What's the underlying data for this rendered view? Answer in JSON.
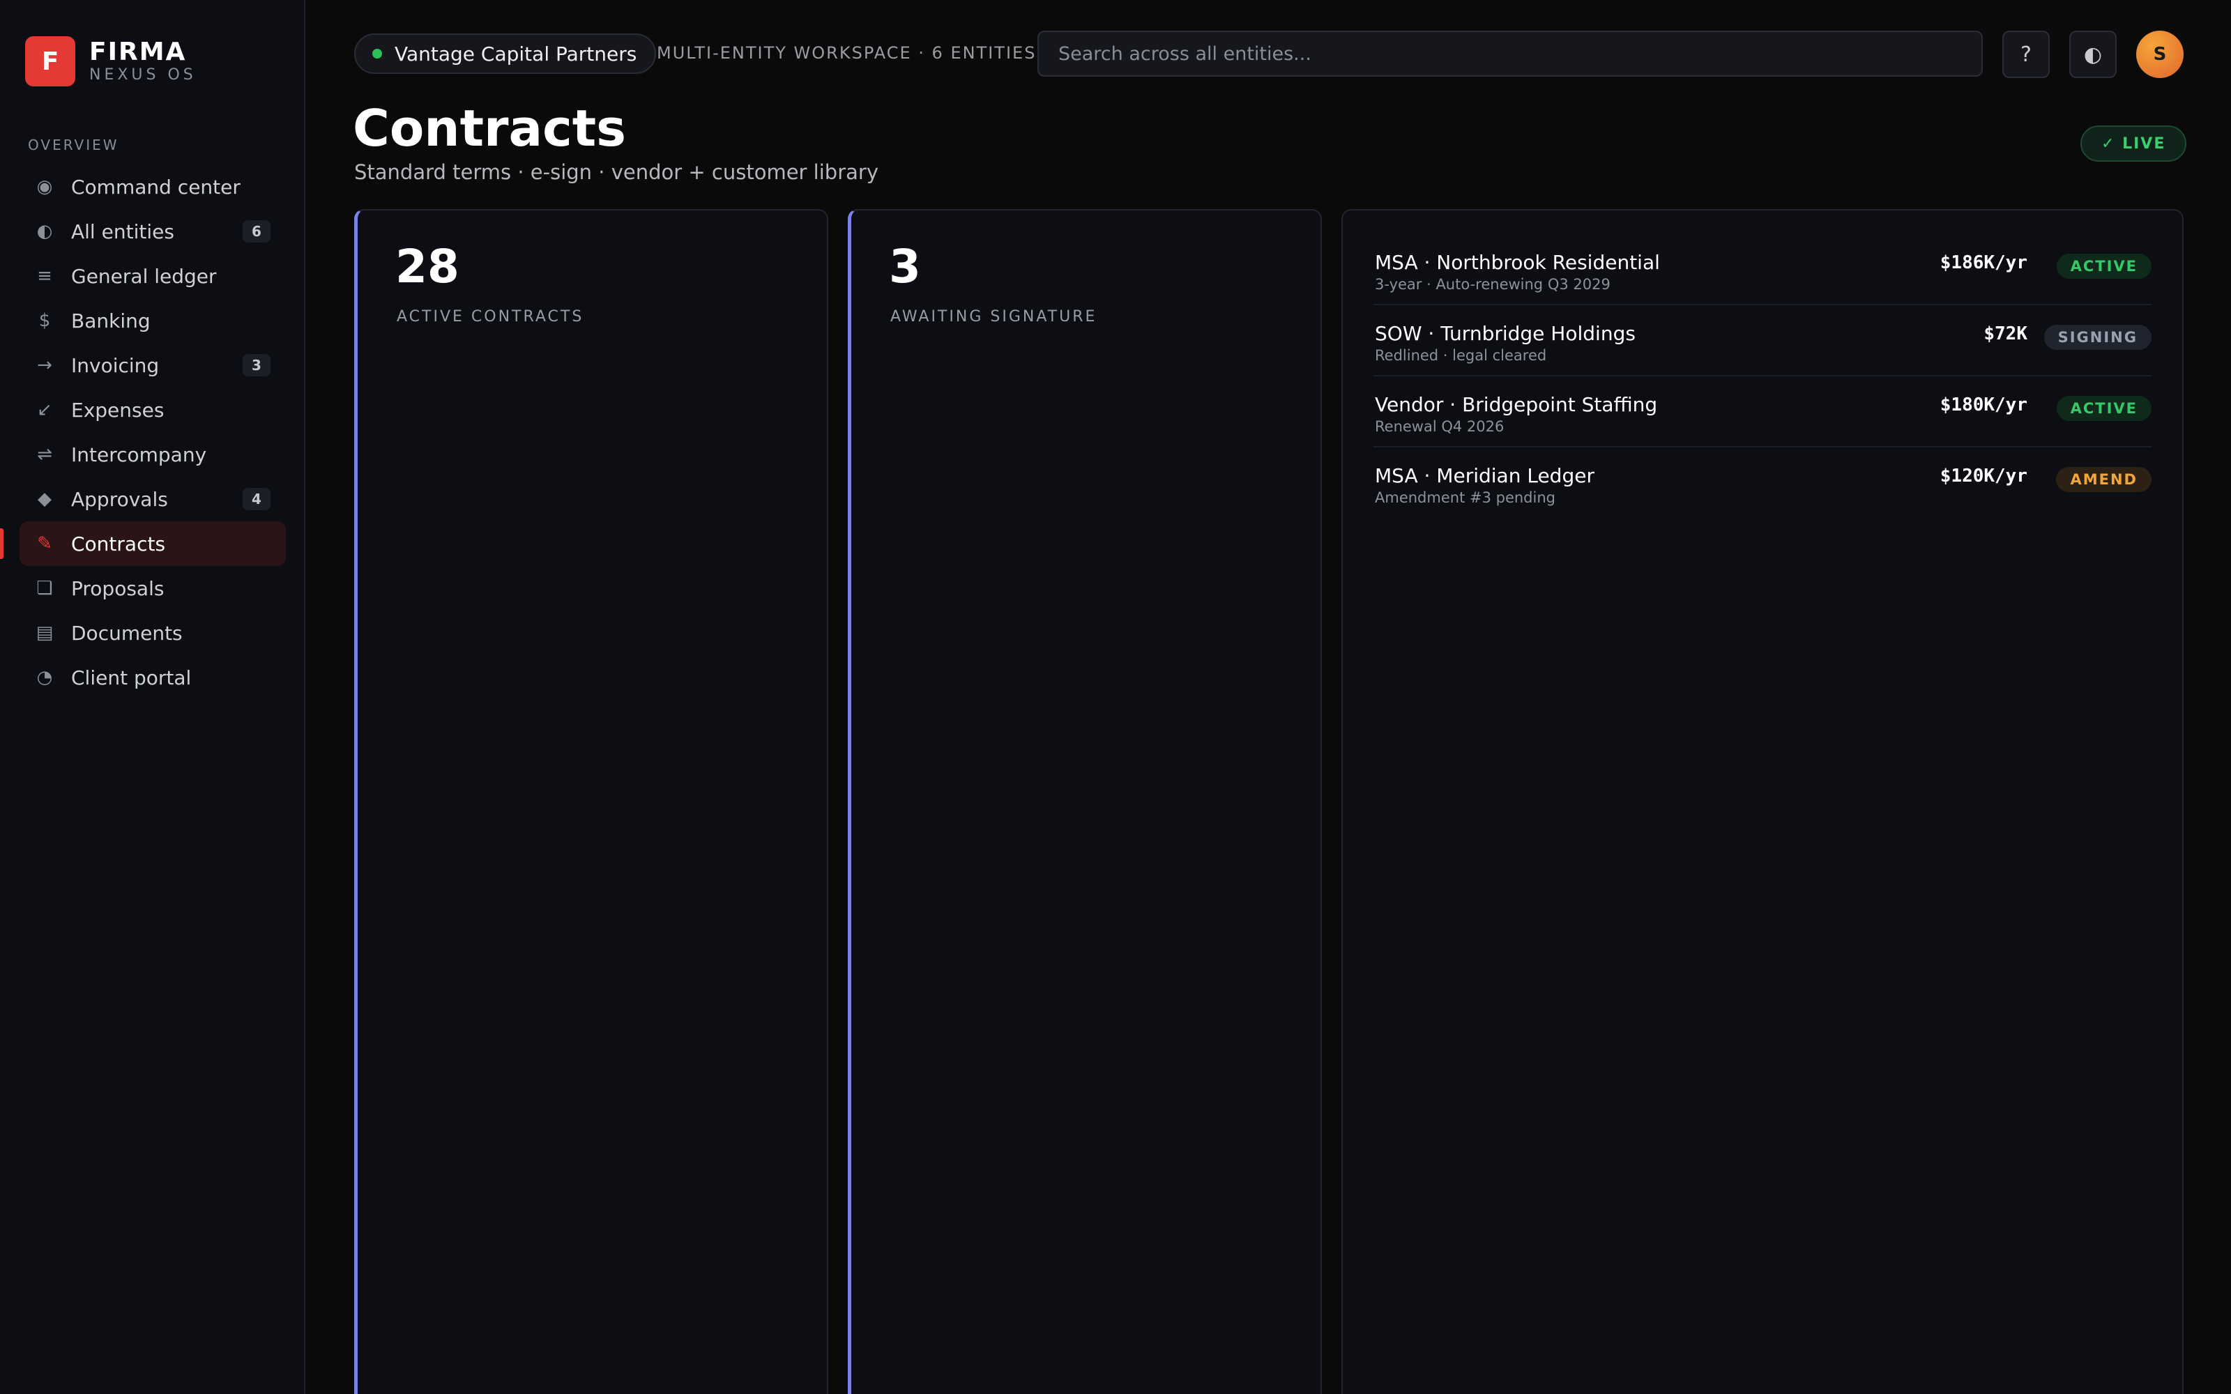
{
  "brand": {
    "logo_letter": "F",
    "name": "FIRMA",
    "subtitle": "NEXUS OS",
    "accent": "#e53935"
  },
  "sidebar": {
    "section_label": "OVERVIEW",
    "items": [
      {
        "label": "Command center",
        "icon": "◉",
        "count": null
      },
      {
        "label": "All entities",
        "icon": "◐",
        "count": "6"
      },
      {
        "label": "General ledger",
        "icon": "≡",
        "count": null
      },
      {
        "label": "Banking",
        "icon": "$",
        "count": null
      },
      {
        "label": "Invoicing",
        "icon": "→",
        "count": "3"
      },
      {
        "label": "Expenses",
        "icon": "↙",
        "count": null
      },
      {
        "label": "Intercompany",
        "icon": "⇌",
        "count": null
      },
      {
        "label": "Approvals",
        "icon": "◆",
        "count": "4"
      },
      {
        "label": "Contracts",
        "icon": "✎",
        "count": null
      },
      {
        "label": "Proposals",
        "icon": "❏",
        "count": null
      },
      {
        "label": "Documents",
        "icon": "▤",
        "count": null
      },
      {
        "label": "Client portal",
        "icon": "◔",
        "count": null
      }
    ],
    "active_index": 8
  },
  "topbar": {
    "entity_name": "Vantage Capital Partners",
    "entity_status_color": "#2fbf5b",
    "workspace_label": "MULTI-ENTITY WORKSPACE · 6 ENTITIES",
    "search_placeholder": "Search across all entities...",
    "help_icon": "?",
    "theme_icon": "◐",
    "avatar_initial": "S"
  },
  "header": {
    "title": "Contracts",
    "subtitle": "Standard terms · e-sign · vendor + customer library",
    "live_badge": "✓ LIVE"
  },
  "stats": [
    {
      "value": "28",
      "label": "ACTIVE CONTRACTS"
    },
    {
      "value": "3",
      "label": "AWAITING SIGNATURE"
    }
  ],
  "contracts": [
    {
      "title": "MSA · Northbrook Residential",
      "detail": "3-year · Auto-renewing Q3 2029",
      "amount": "$186K/yr",
      "status": "ACTIVE",
      "status_kind": "active"
    },
    {
      "title": "SOW · Turnbridge Holdings",
      "detail": "Redlined · legal cleared",
      "amount": "$72K",
      "status": "SIGNING",
      "status_kind": "signing"
    },
    {
      "title": "Vendor · Bridgepoint Staffing",
      "detail": "Renewal Q4 2026",
      "amount": "$180K/yr",
      "status": "ACTIVE",
      "status_kind": "active"
    },
    {
      "title": "MSA · Meridian Ledger",
      "detail": "Amendment #3 pending",
      "amount": "$120K/yr",
      "status": "AMEND",
      "status_kind": "amend"
    }
  ]
}
